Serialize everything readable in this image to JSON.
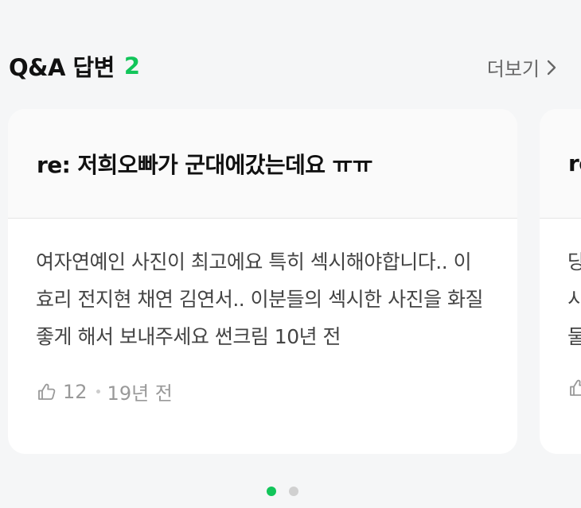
{
  "section": {
    "title": "Q&A 답변",
    "count": "2",
    "more_label": "더보기",
    "accent_color": "#12c55a"
  },
  "cards": [
    {
      "title": "re: 저희오빠가 군대에갔는데요 ㅠㅠ",
      "body": "여자연예인 사진이 최고에요 특히 섹시해야합니다.. 이효리 전지현 채연 김연서.. 이분들의 섹시한 사진을 화질좋게 해서 보내주세요 썬크림 10년 전",
      "likes": "12",
      "time": "19년 전"
    },
    {
      "title": "re",
      "body": "당\n시\n둘",
      "likes": "",
      "time": ""
    }
  ],
  "pagination": {
    "total": 2,
    "active": 0
  }
}
